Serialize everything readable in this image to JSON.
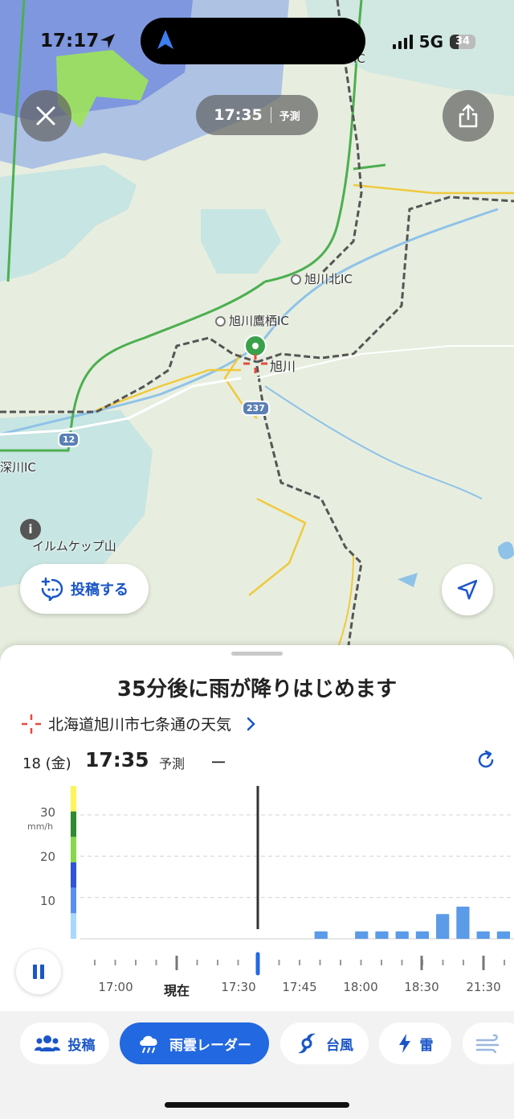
{
  "status_bar": {
    "time": "17:17",
    "network": "5G",
    "battery": "34",
    "battery_level": 0.34
  },
  "map": {
    "time_pill": {
      "time": "17:35",
      "label": "予測"
    },
    "labels": {
      "asahikawa_kita_ic": "旭川北IC",
      "asahikawa_takasu_ic": "旭川鷹栖IC",
      "asahikawa": "旭川",
      "fukagawa_ic": "深川IC",
      "irumukeppu": "イルムケップ山",
      "route_237": "237",
      "route_12": "12",
      "edge_ic": "IC"
    },
    "post_button": "投稿する",
    "info_icon": "i"
  },
  "sheet": {
    "headline": "35分後に雨が降りはじめます",
    "location": "北海道旭川市七条通の天気",
    "date": "18 (金)",
    "time": "17:35",
    "forecast_label": "予測",
    "amount": "ー"
  },
  "chart_data": {
    "type": "bar",
    "ylabel": "mm/h",
    "yticks": [
      "10",
      "20",
      "30"
    ],
    "ylim": [
      0,
      37
    ],
    "current_time_marker": "17:35",
    "tick_labels": [
      {
        "label": "17:00",
        "is_now": false
      },
      {
        "label": "現在",
        "is_now": true
      },
      {
        "label": "17:30",
        "is_now": false
      },
      {
        "label": "17:45",
        "is_now": false
      },
      {
        "label": "18:00",
        "is_now": false
      },
      {
        "label": "18:30",
        "is_now": false
      },
      {
        "label": "21:30",
        "is_now": false
      }
    ],
    "bars_mm_per_h": [
      0,
      0,
      0,
      0,
      0,
      0,
      0,
      0,
      0,
      0,
      0,
      1.8,
      0,
      1.8,
      1.8,
      1.8,
      1.8,
      6,
      7.8,
      1.8,
      1.8
    ],
    "legend_colors": [
      "#fff35a",
      "#2e8b2e",
      "#86d94a",
      "#2e54d8",
      "#5a8ff0",
      "#a8d8ff"
    ]
  },
  "bottom_tabs": [
    {
      "label": "投稿",
      "icon": "people-icon"
    },
    {
      "label": "雨雲レーダー",
      "icon": "rain-cloud-icon",
      "active": true
    },
    {
      "label": "台風",
      "icon": "typhoon-icon"
    },
    {
      "label": "雷",
      "icon": "lightning-icon"
    }
  ]
}
